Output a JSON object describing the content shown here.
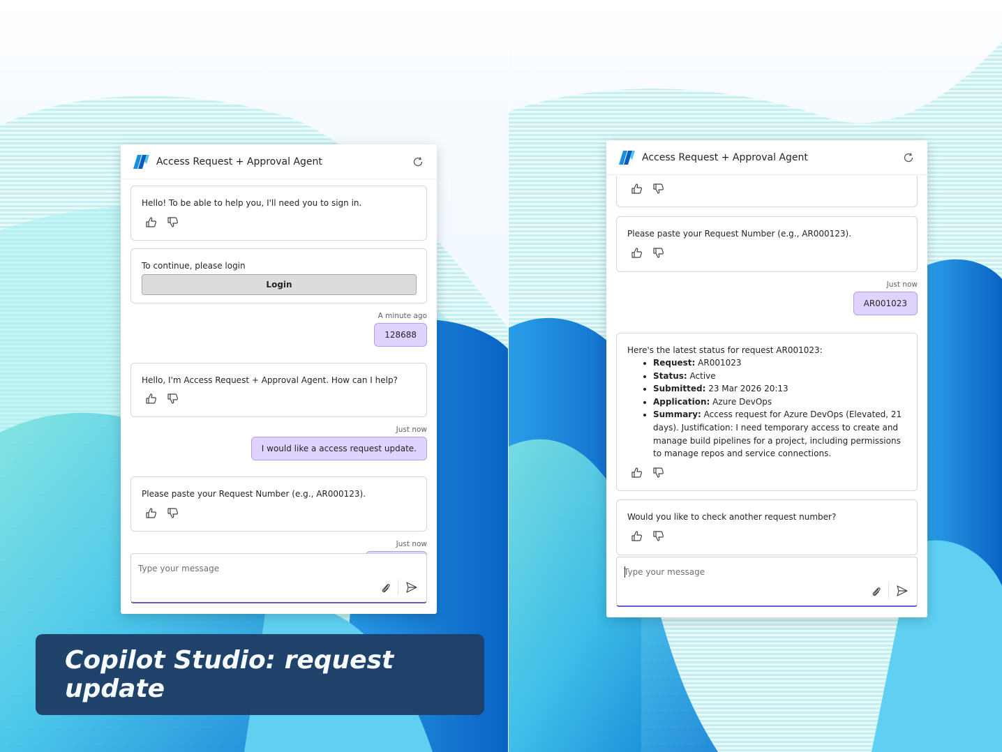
{
  "left_window": {
    "title": "Access Request + Approval Agent",
    "messages": {
      "greeting": "Hello! To be able to help you, I'll need you to sign in.",
      "login_prompt": "To continue, please login",
      "login_button": "Login",
      "ts1": "A minute ago",
      "user_code": "128688",
      "intro": "Hello, I'm Access Request + Approval Agent. How can I help?",
      "ts2": "Just now",
      "user_request": "I would like a access request update.",
      "paste_prompt": "Please paste your Request Number (e.g., AR000123).",
      "ts3": "Just now"
    },
    "composer": {
      "placeholder": "Type your message"
    }
  },
  "right_window": {
    "title": "Access Request + Approval Agent",
    "messages": {
      "paste_prompt": "Please paste your Request Number (e.g., AR000123).",
      "ts1": "Just now",
      "user_request_number": "AR001023",
      "status_intro": "Here's the latest status for request AR001023:",
      "status_items": [
        {
          "label": "Request:",
          "value": " AR001023"
        },
        {
          "label": "Status:",
          "value": " Active"
        },
        {
          "label": "Submitted:",
          "value": " 23 Mar 2026 20:13"
        },
        {
          "label": "Application:",
          "value": " Azure DevOps"
        },
        {
          "label": "Summary:",
          "value": " Access request for Azure DevOps (Elevated, 21 days). Justification: I need temporary access to create and manage build pipelines for a project, including permissions to manage repos and service connections."
        }
      ],
      "followup": "Would you like to check another request number?"
    },
    "composer": {
      "placeholder": "Type your message"
    }
  },
  "caption": "Copilot Studio: request update",
  "colors": {
    "user_bubble": "#e0d3ff",
    "accent": "#5b5fc7",
    "caption_bg": "#1f3e66"
  },
  "icons": [
    "agent-logo-icon",
    "refresh-icon",
    "thumbs-up-icon",
    "thumbs-down-icon",
    "paperclip-icon",
    "send-icon"
  ]
}
